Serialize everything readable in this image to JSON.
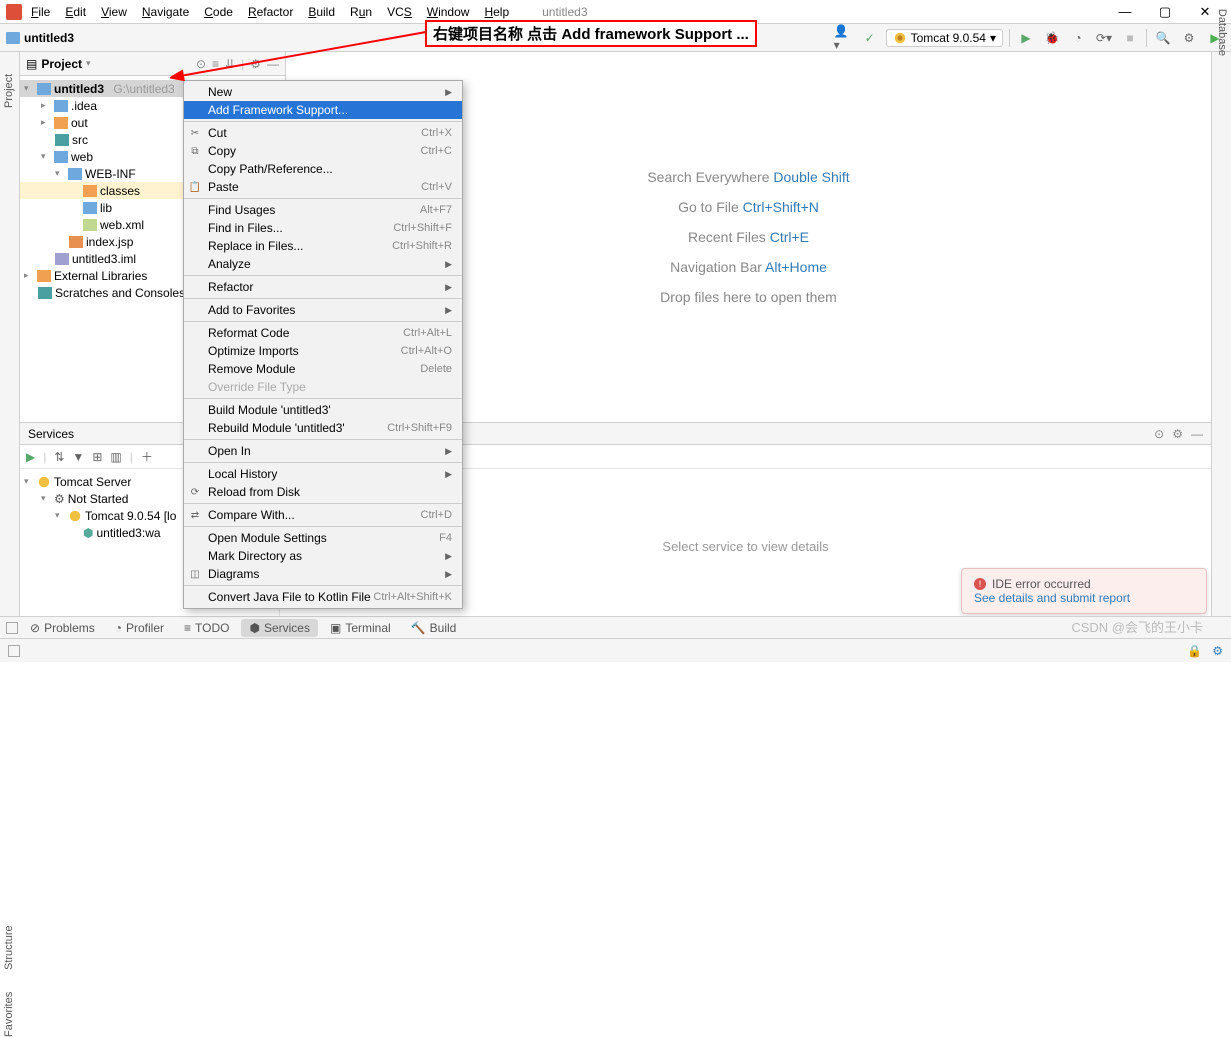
{
  "menu": {
    "items": [
      "File",
      "Edit",
      "View",
      "Navigate",
      "Code",
      "Refactor",
      "Build",
      "Run",
      "VCS",
      "Window",
      "Help"
    ],
    "title": "untitled3"
  },
  "crumb": {
    "project": "untitled3"
  },
  "annotation": "右键项目名称 点击 Add framework Support ...",
  "runconfig": {
    "label": "Tomcat 9.0.54",
    "dropdown": "▾"
  },
  "projpanel": {
    "title": "Project"
  },
  "tree": {
    "root": {
      "name": "untitled3",
      "path": "G:\\untitled3"
    },
    "idea": ".idea",
    "out": "out",
    "src": "src",
    "web": "web",
    "webinf": "WEB-INF",
    "classes": "classes",
    "lib": "lib",
    "webxml": "web.xml",
    "indexjsp": "index.jsp",
    "iml": "untitled3.iml",
    "extlib": "External Libraries",
    "scratches": "Scratches and Consoles"
  },
  "ctx": {
    "new": "New",
    "addfw": "Add Framework Support...",
    "cut": "Cut",
    "cut_sc": "Ctrl+X",
    "copy": "Copy",
    "copy_sc": "Ctrl+C",
    "copypath": "Copy Path/Reference...",
    "paste": "Paste",
    "paste_sc": "Ctrl+V",
    "findusages": "Find Usages",
    "findusages_sc": "Alt+F7",
    "findinfiles": "Find in Files...",
    "findinfiles_sc": "Ctrl+Shift+F",
    "replaceinfiles": "Replace in Files...",
    "replaceinfiles_sc": "Ctrl+Shift+R",
    "analyze": "Analyze",
    "refactor": "Refactor",
    "addfav": "Add to Favorites",
    "reformat": "Reformat Code",
    "reformat_sc": "Ctrl+Alt+L",
    "optimize": "Optimize Imports",
    "optimize_sc": "Ctrl+Alt+O",
    "remove": "Remove Module",
    "remove_sc": "Delete",
    "override": "Override File Type",
    "buildmod": "Build Module 'untitled3'",
    "rebuildmod": "Rebuild Module 'untitled3'",
    "rebuildmod_sc": "Ctrl+Shift+F9",
    "openin": "Open In",
    "localhist": "Local History",
    "reload": "Reload from Disk",
    "compare": "Compare With...",
    "compare_sc": "Ctrl+D",
    "openmod": "Open Module Settings",
    "openmod_sc": "F4",
    "markdir": "Mark Directory as",
    "diagrams": "Diagrams",
    "convert": "Convert Java File to Kotlin File",
    "convert_sc": "Ctrl+Alt+Shift+K"
  },
  "editor": {
    "l1a": "Search Everywhere ",
    "l1b": "Double Shift",
    "l2a": "Go to File ",
    "l2b": "Ctrl+Shift+N",
    "l3a": "Recent Files ",
    "l3b": "Ctrl+E",
    "l4a": "Navigation Bar ",
    "l4b": "Alt+Home",
    "l5": "Drop files here to open them"
  },
  "services": {
    "title": "Services",
    "placeholder": "Select service to view details",
    "tree": {
      "root": "Tomcat Server",
      "notstarted": "Not Started",
      "tomcat": "Tomcat 9.0.54 [lo",
      "war": "untitled3:wa"
    }
  },
  "bottom": {
    "problems": "Problems",
    "profiler": "Profiler",
    "todo": "TODO",
    "services": "Services",
    "terminal": "Terminal",
    "build": "Build"
  },
  "balloon": {
    "title": "IDE error occurred",
    "link": "See details and submit report"
  },
  "watermark": "CSDN @会飞的王小卡",
  "dock": {
    "project": "Project",
    "structure": "Structure",
    "favorites": "Favorites",
    "database": "Database"
  }
}
